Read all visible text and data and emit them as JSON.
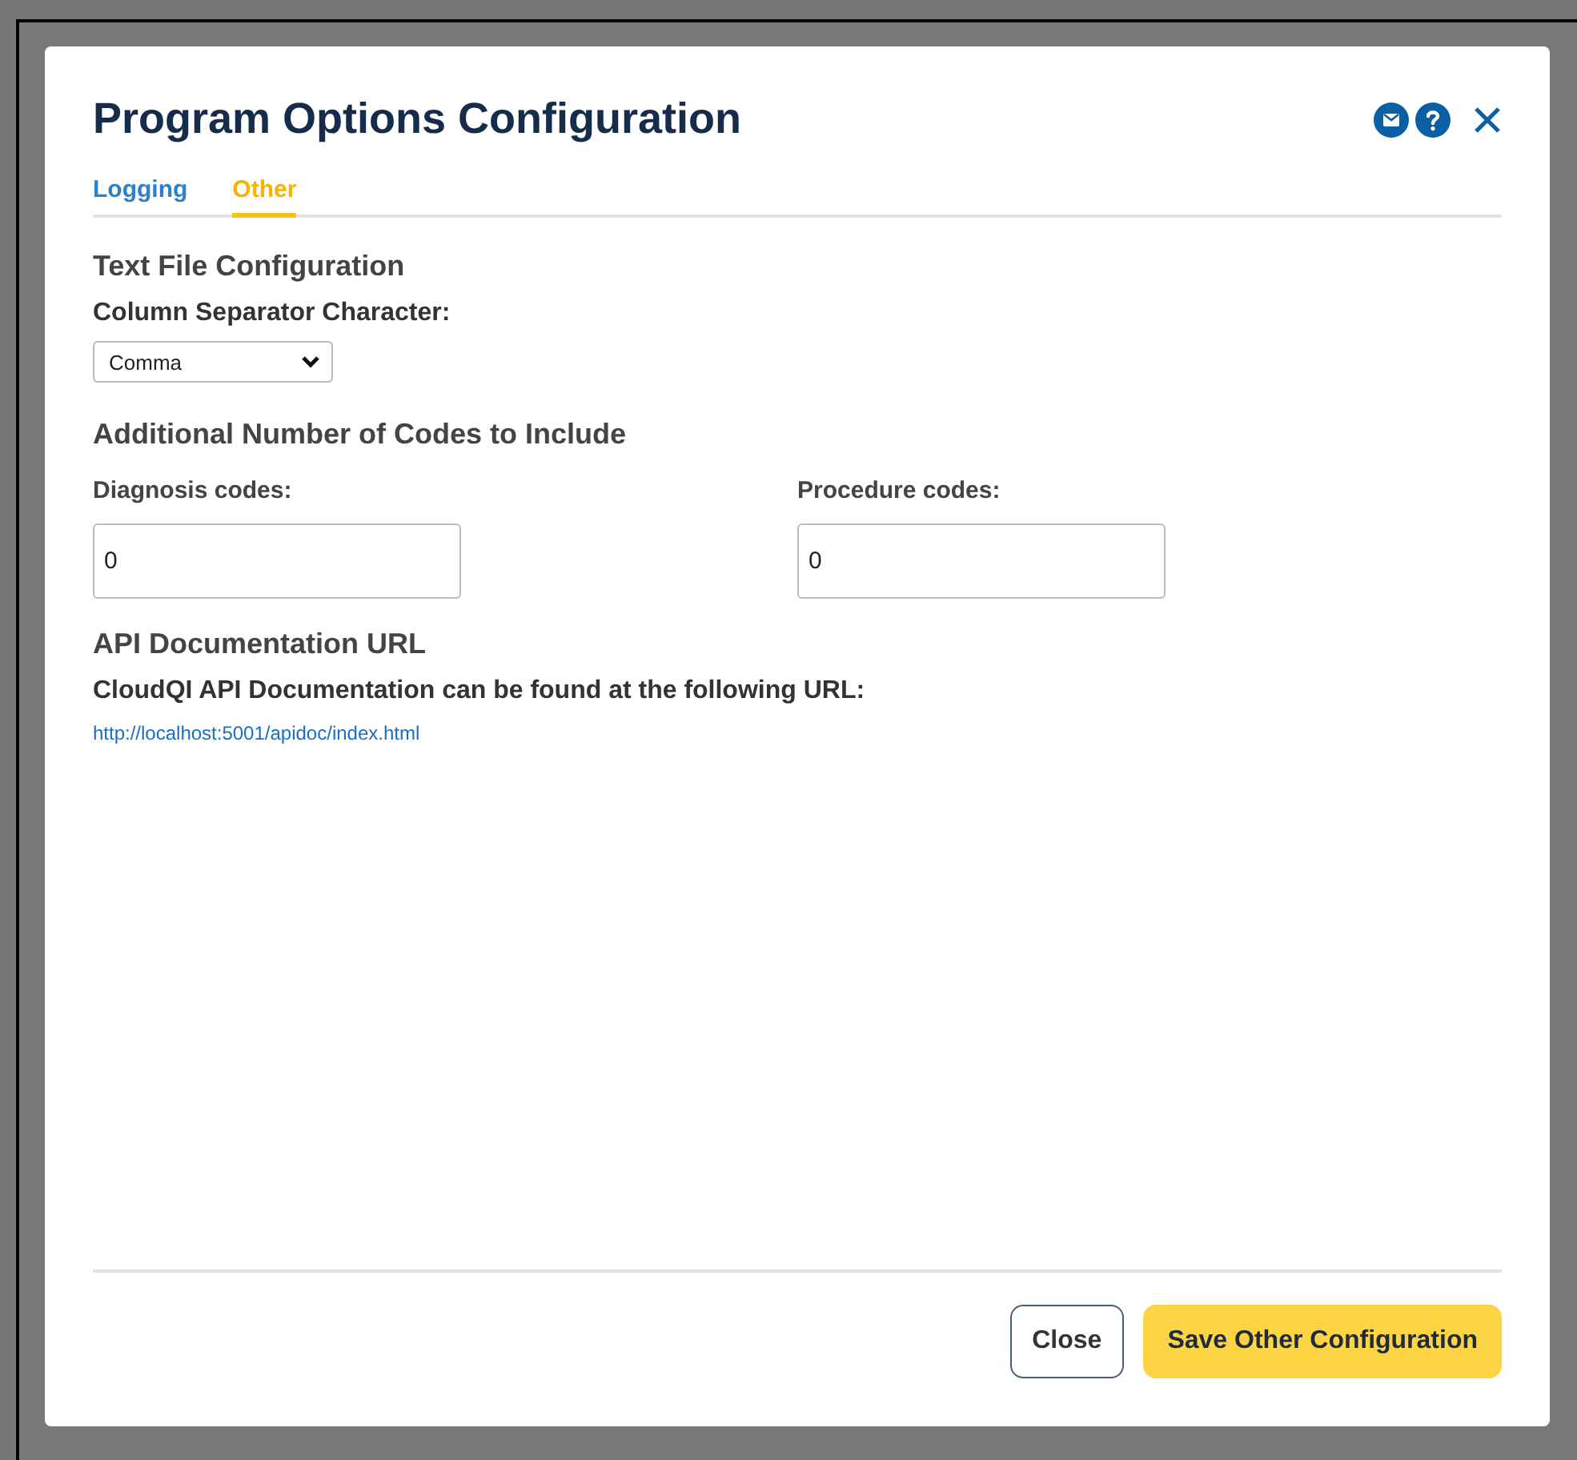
{
  "dialog": {
    "title": "Program Options Configuration",
    "tabs": [
      {
        "label": "Logging",
        "selected": false
      },
      {
        "label": "Other",
        "selected": true
      }
    ],
    "sections": [
      {
        "kind": "select",
        "heading": "Text File Configuration",
        "label": "Column Separator Character:",
        "value": "Comma"
      },
      {
        "kind": "numbers",
        "heading": "Additional Number of Codes to Include",
        "fields": [
          {
            "label": "Diagnosis codes:",
            "value": "0"
          },
          {
            "label": "Procedure codes:",
            "value": "0"
          }
        ]
      },
      {
        "kind": "link",
        "heading": "API Documentation URL",
        "text": "CloudQI API Documentation can be found at the following URL:",
        "url": "http://localhost:5001/apidoc/index.html"
      }
    ],
    "buttons": [
      {
        "label": "Close",
        "kind": "secondary"
      },
      {
        "label": "Save Other Configuration",
        "kind": "primary"
      }
    ]
  }
}
